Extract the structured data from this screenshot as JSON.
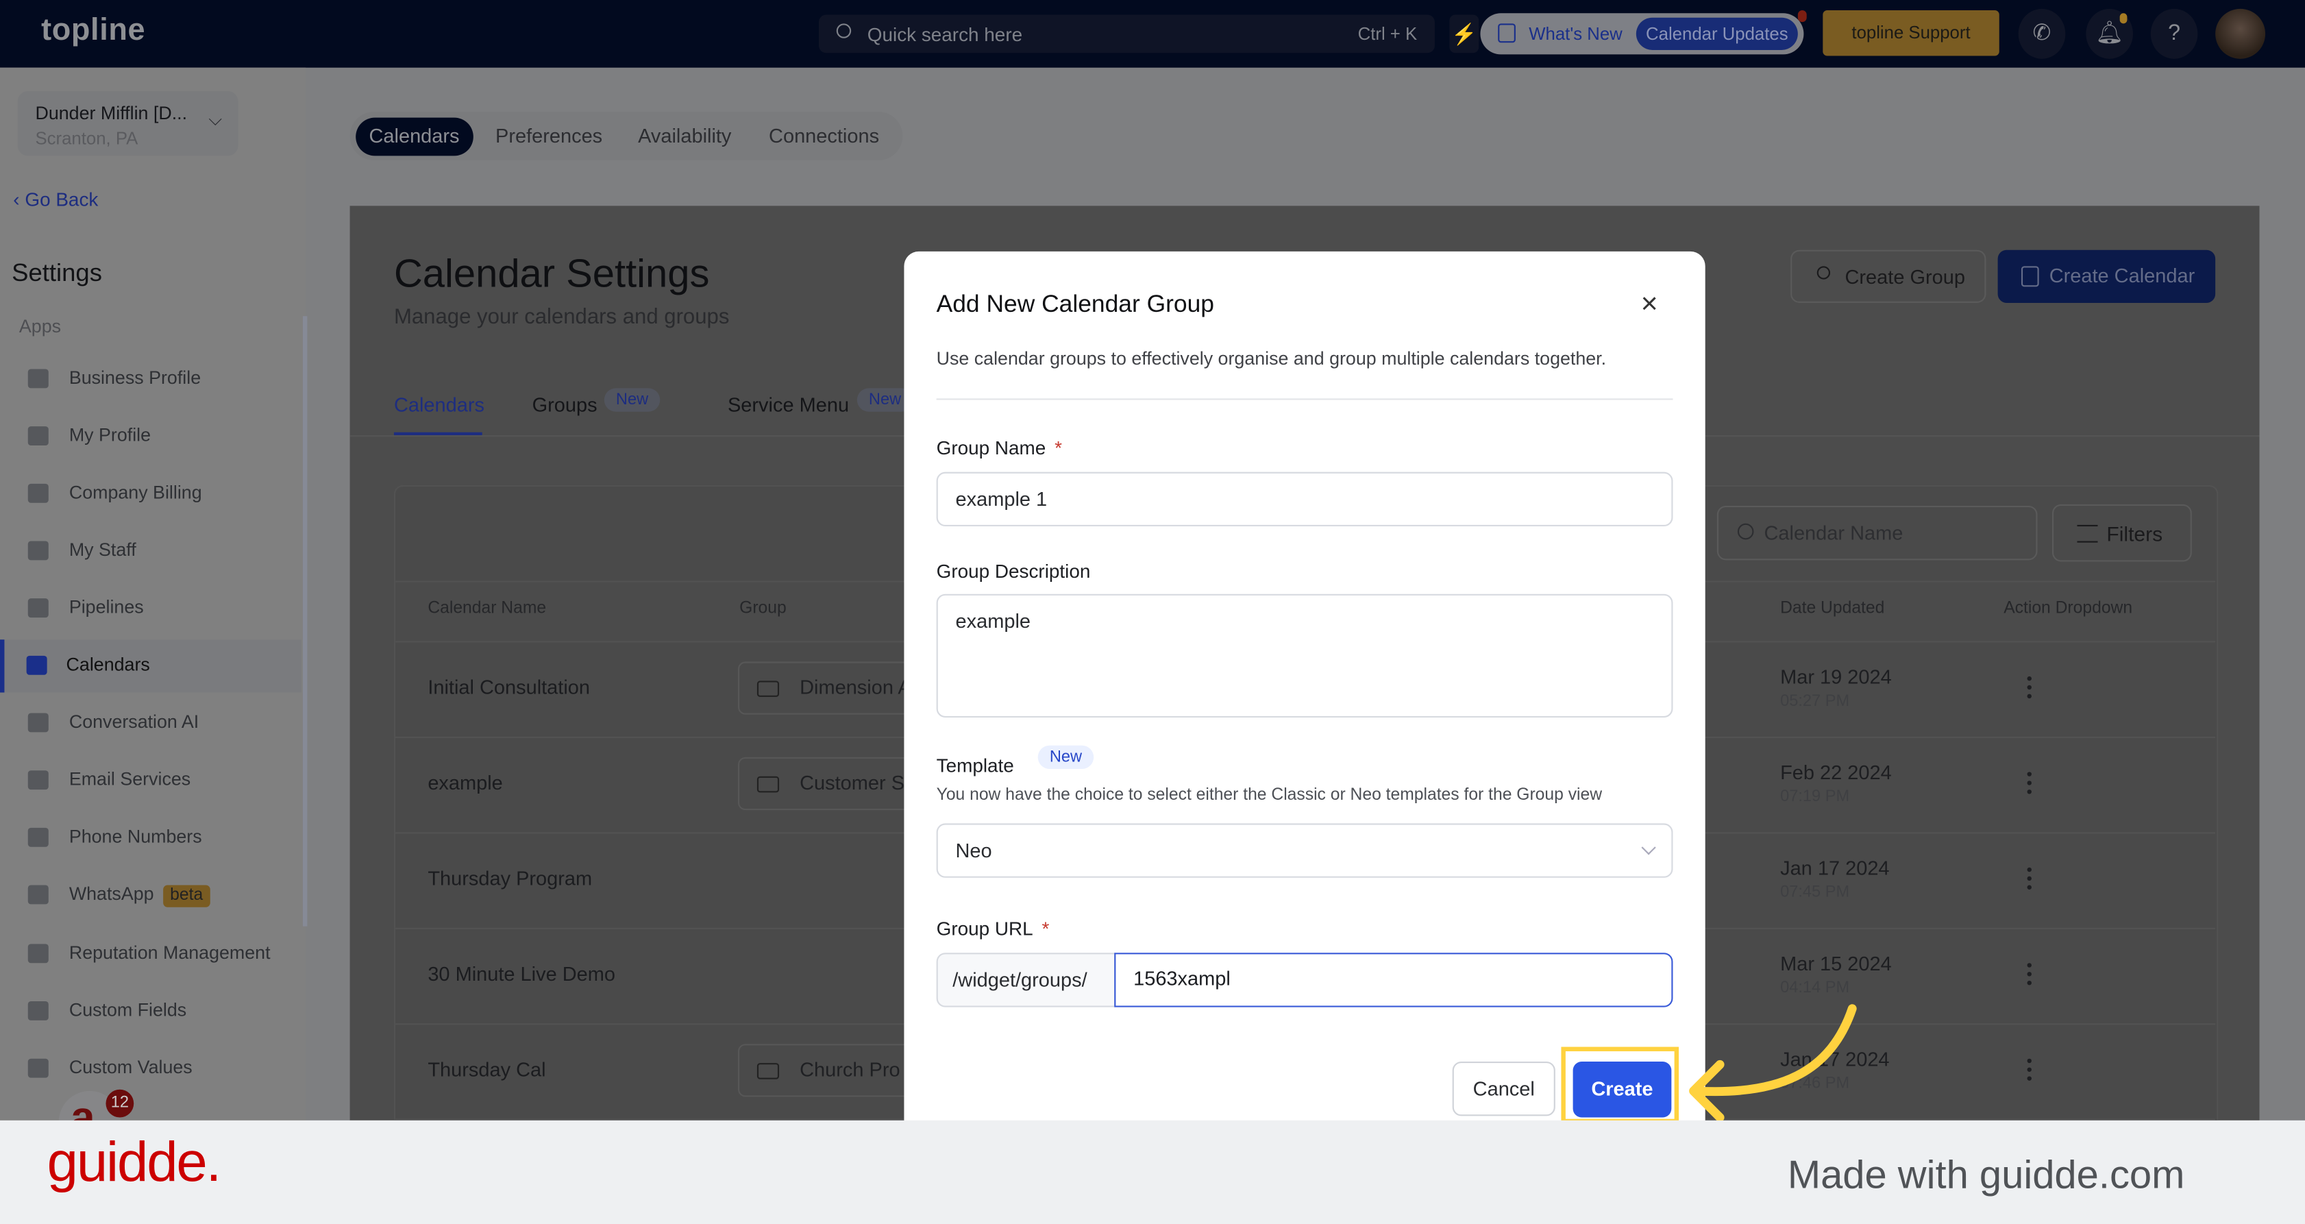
{
  "topbar": {
    "logo": "topline",
    "search_placeholder": "Quick search here",
    "search_shortcut": "Ctrl + K",
    "whats_new": "What's New",
    "calendar_updates": "Calendar Updates",
    "support": "topline Support"
  },
  "sidebar": {
    "account_name": "Dunder Mifflin [D...",
    "account_location": "Scranton, PA",
    "go_back": "Go Back",
    "heading": "Settings",
    "section": "Apps",
    "items": [
      {
        "label": "Business Profile",
        "icon": "briefcase-icon"
      },
      {
        "label": "My Profile",
        "icon": "user-icon"
      },
      {
        "label": "Company Billing",
        "icon": "grid-icon"
      },
      {
        "label": "My Staff",
        "icon": "staff-icon"
      },
      {
        "label": "Pipelines",
        "icon": "pipeline-icon"
      },
      {
        "label": "Calendars",
        "icon": "calendar-icon",
        "active": true
      },
      {
        "label": "Conversation AI",
        "icon": "chat-icon"
      },
      {
        "label": "Email Services",
        "icon": "mail-icon"
      },
      {
        "label": "Phone Numbers",
        "icon": "phone-icon"
      },
      {
        "label": "WhatsApp",
        "icon": "whatsapp-icon",
        "badge": "beta"
      },
      {
        "label": "Reputation Management",
        "icon": "star-icon"
      },
      {
        "label": "Custom Fields",
        "icon": "edit-icon"
      },
      {
        "label": "Custom Values",
        "icon": "pie-icon"
      }
    ],
    "chat_badge_count": "12"
  },
  "top_tabs": [
    "Calendars",
    "Preferences",
    "Availability",
    "Connections"
  ],
  "page": {
    "title": "Calendar Settings",
    "subtitle": "Manage your calendars and groups",
    "create_group": "Create Group",
    "create_calendar": "Create Calendar",
    "sub_tabs": [
      {
        "label": "Calendars",
        "active": true
      },
      {
        "label": "Groups",
        "badge": "New"
      },
      {
        "label": "Service Menu",
        "badge": "New"
      }
    ],
    "search_placeholder": "Calendar Name",
    "filters": "Filters"
  },
  "table": {
    "columns": [
      "Calendar Name",
      "Group",
      "Date Updated",
      "Action Dropdown"
    ],
    "rows": [
      {
        "name": "Initial Consultation",
        "group": "Dimension A",
        "date": "Mar 19 2024",
        "time": "05:27 PM"
      },
      {
        "name": "example",
        "group": "Customer S",
        "date": "Feb 22 2024",
        "time": "07:19 PM"
      },
      {
        "name": "Thursday Program",
        "group": "",
        "date": "Jan 17 2024",
        "time": "07:45 PM"
      },
      {
        "name": "30 Minute Live Demo",
        "group": "",
        "date": "Mar 15 2024",
        "time": "04:14 PM"
      },
      {
        "name": "Thursday Cal",
        "group": "Church Pro",
        "date": "Jan 17 2024",
        "time": "07:46 PM"
      }
    ]
  },
  "modal": {
    "title": "Add New Calendar Group",
    "description": "Use calendar groups to effectively organise and group multiple calendars together.",
    "group_name_label": "Group Name",
    "group_name_value": "example 1",
    "group_description_label": "Group Description",
    "group_description_value": "example",
    "template_label": "Template",
    "template_badge": "New",
    "template_help": "You now have the choice to select either the Classic or Neo templates for the Group view",
    "template_value": "Neo",
    "group_url_label": "Group URL",
    "group_url_prefix": "/widget/groups/",
    "group_url_value": "1563xampl",
    "required_mark": "*",
    "cancel": "Cancel",
    "create": "Create"
  },
  "footer": {
    "logo": "guidde.",
    "made_with": "Made with guidde.com"
  },
  "colors": {
    "accent": "#2a56e4",
    "highlight": "#ffd23f",
    "guidde_red": "#cc0000"
  }
}
